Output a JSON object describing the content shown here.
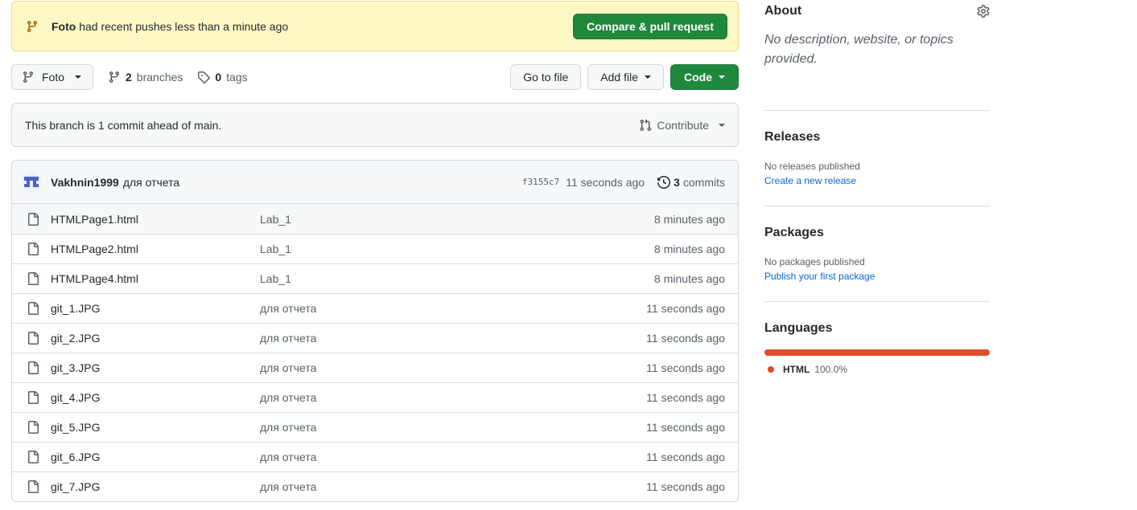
{
  "push_banner": {
    "branch": "Foto",
    "message": "had recent pushes less than a minute ago",
    "button": "Compare & pull request"
  },
  "toolbar": {
    "branch_name": "Foto",
    "branches_count": "2",
    "branches_label": "branches",
    "tags_count": "0",
    "tags_label": "tags",
    "go_to_file": "Go to file",
    "add_file": "Add file",
    "code": "Code"
  },
  "ahead": {
    "text": "This branch is 1 commit ahead of main.",
    "contribute": "Contribute"
  },
  "latest_commit": {
    "author": "Vakhnin1999",
    "message": "для отчета",
    "sha": "f3155c7",
    "time": "11 seconds ago",
    "commits_count": "3",
    "commits_label": "commits"
  },
  "files": [
    {
      "name": "HTMLPage1.html",
      "message": "Lab_1",
      "time": "8 minutes ago"
    },
    {
      "name": "HTMLPage2.html",
      "message": "Lab_1",
      "time": "8 minutes ago"
    },
    {
      "name": "HTMLPage4.html",
      "message": "Lab_1",
      "time": "8 minutes ago"
    },
    {
      "name": "git_1.JPG",
      "message": "для отчета",
      "time": "11 seconds ago"
    },
    {
      "name": "git_2.JPG",
      "message": "для отчета",
      "time": "11 seconds ago"
    },
    {
      "name": "git_3.JPG",
      "message": "для отчета",
      "time": "11 seconds ago"
    },
    {
      "name": "git_4.JPG",
      "message": "для отчета",
      "time": "11 seconds ago"
    },
    {
      "name": "git_5.JPG",
      "message": "для отчета",
      "time": "11 seconds ago"
    },
    {
      "name": "git_6.JPG",
      "message": "для отчета",
      "time": "11 seconds ago"
    },
    {
      "name": "git_7.JPG",
      "message": "для отчета",
      "time": "11 seconds ago"
    }
  ],
  "sidebar": {
    "about": {
      "title": "About",
      "description": "No description, website, or topics provided."
    },
    "releases": {
      "title": "Releases",
      "empty": "No releases published",
      "link": "Create a new release"
    },
    "packages": {
      "title": "Packages",
      "empty": "No packages published",
      "link": "Publish your first package"
    },
    "languages": {
      "title": "Languages",
      "items": [
        {
          "name": "HTML",
          "percent": "100.0%",
          "color": "#e34c26"
        }
      ]
    }
  },
  "colors": {
    "primary_button": "#1f883d",
    "banner_bg": "#fff8c5",
    "link": "#0969da"
  }
}
